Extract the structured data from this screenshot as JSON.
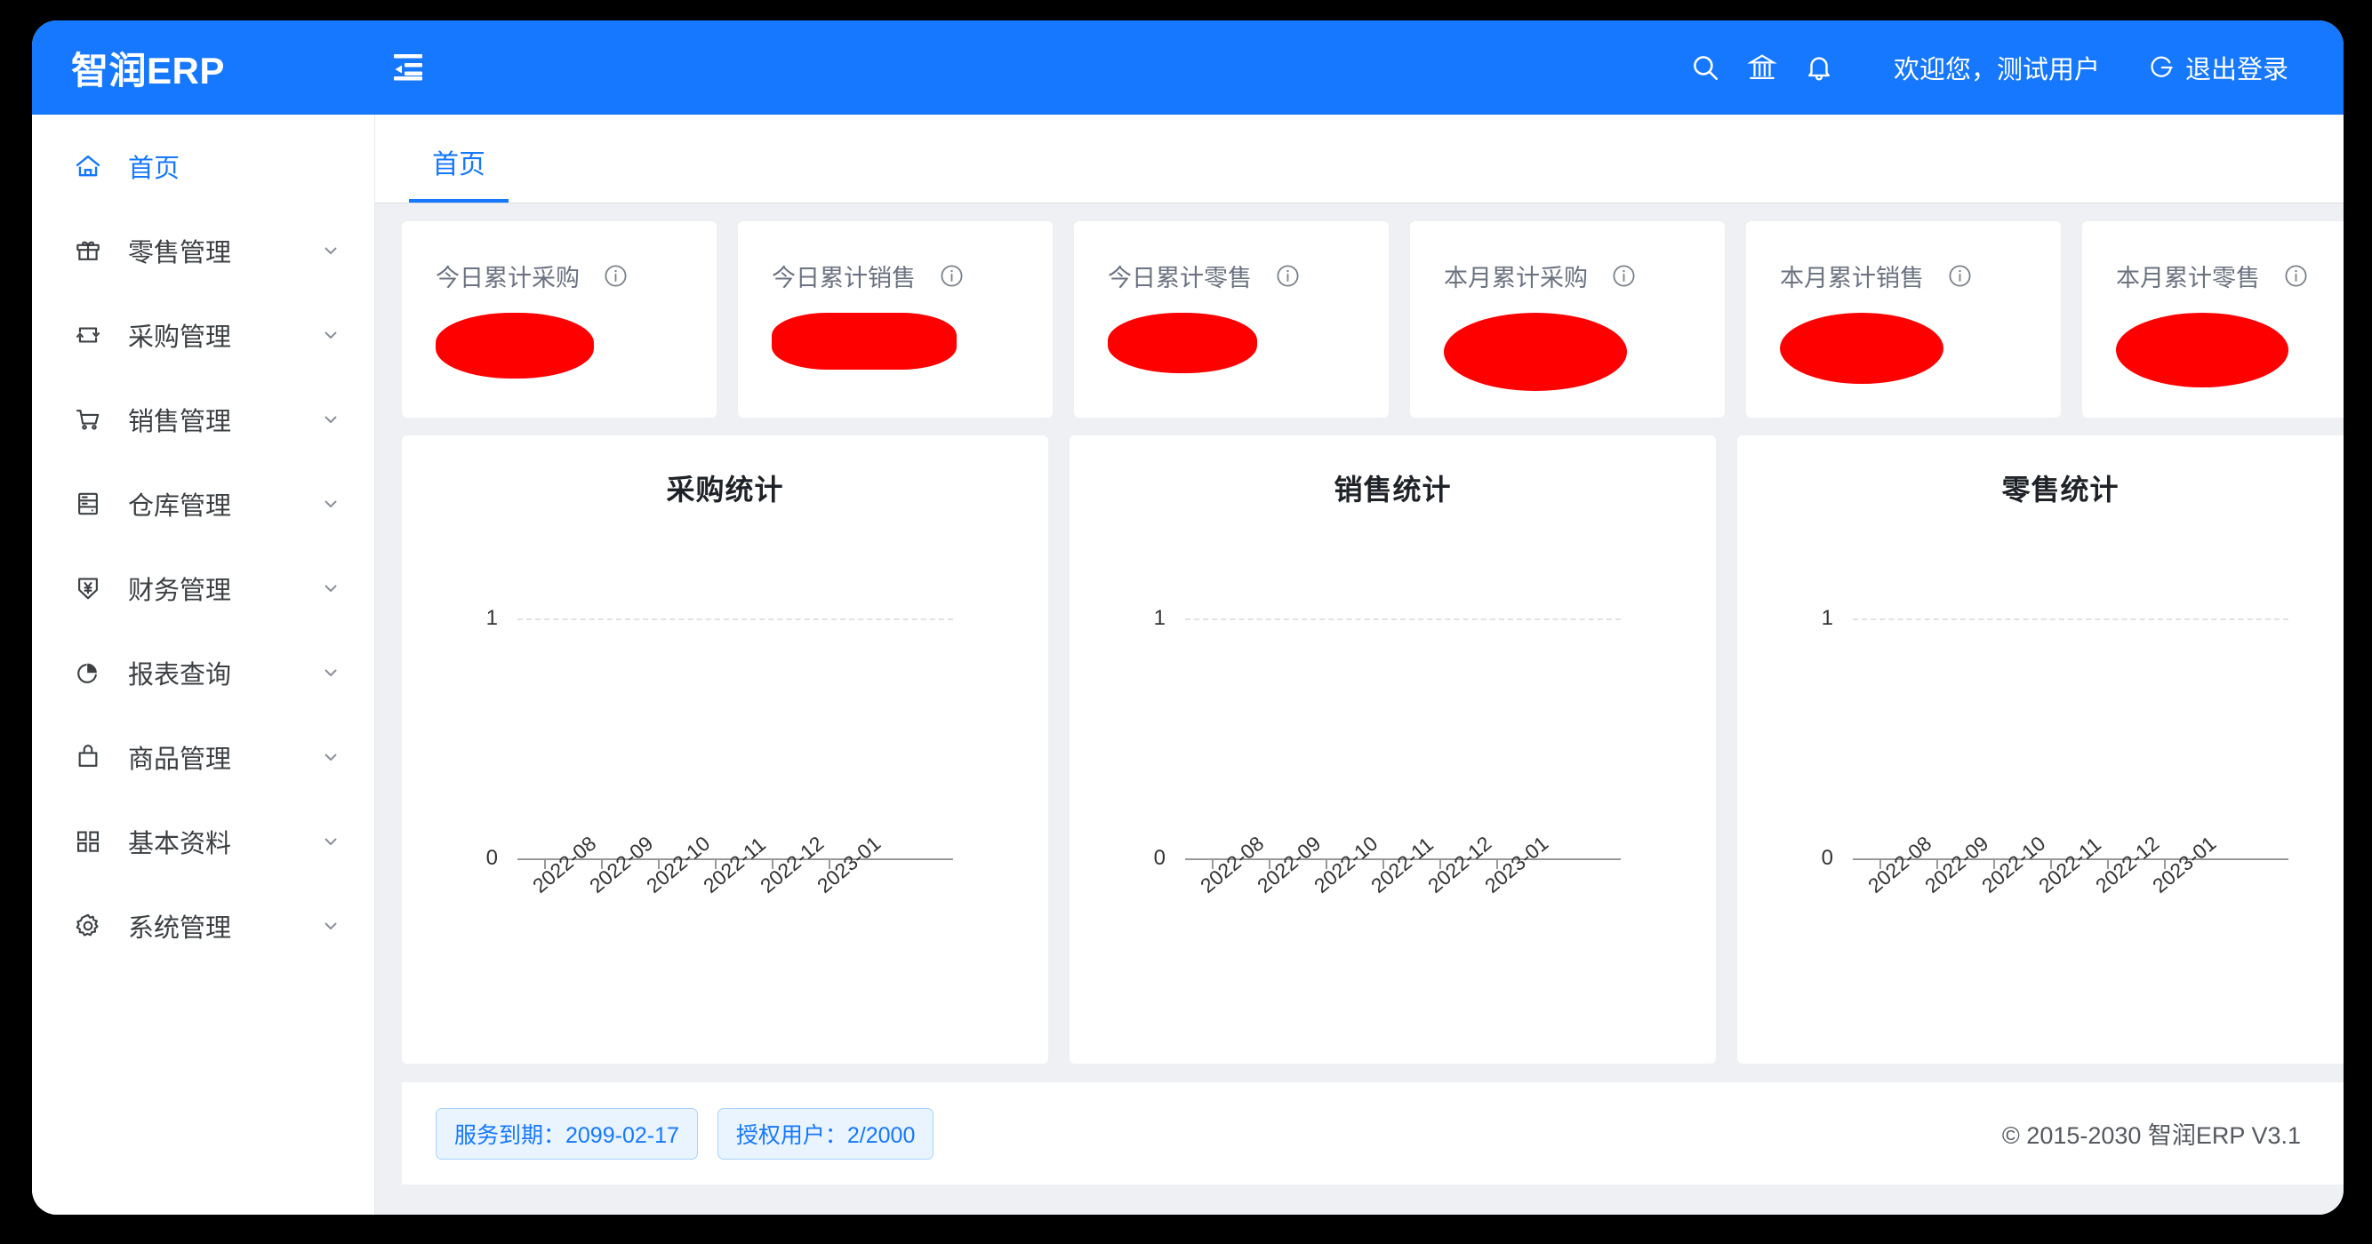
{
  "app": {
    "logo": "智润ERP"
  },
  "header": {
    "fold_icon": "menu-fold-icon",
    "search_icon": "search-icon",
    "enterprise_icon": "bank-icon",
    "bell_icon": "bell-icon",
    "welcome": "欢迎您，测试用户",
    "logout_label": "退出登录",
    "logout_icon": "logout-icon",
    "background_color": "#1677ff"
  },
  "sidebar": {
    "items": [
      {
        "label": "首页",
        "icon": "home-icon",
        "active": true,
        "expandable": false
      },
      {
        "label": "零售管理",
        "icon": "gift-icon",
        "active": false,
        "expandable": true
      },
      {
        "label": "采购管理",
        "icon": "sync-icon",
        "active": false,
        "expandable": true
      },
      {
        "label": "销售管理",
        "icon": "shopping-cart-icon",
        "active": false,
        "expandable": true
      },
      {
        "label": "仓库管理",
        "icon": "database-icon",
        "active": false,
        "expandable": true
      },
      {
        "label": "财务管理",
        "icon": "yen-shield-icon",
        "active": false,
        "expandable": true
      },
      {
        "label": "报表查询",
        "icon": "pie-chart-icon",
        "active": false,
        "expandable": true
      },
      {
        "label": "商品管理",
        "icon": "bag-icon",
        "active": false,
        "expandable": true
      },
      {
        "label": "基本资料",
        "icon": "appstore-icon",
        "active": false,
        "expandable": true
      },
      {
        "label": "系统管理",
        "icon": "gear-icon",
        "active": false,
        "expandable": true
      }
    ]
  },
  "tabs": [
    {
      "label": "首页",
      "active": true
    }
  ],
  "stats": [
    {
      "label": "今日累计采购",
      "value": "",
      "redacted": true,
      "info_icon": "info-circle-icon",
      "blob_w": 178,
      "blob_h": 74
    },
    {
      "label": "今日累计销售",
      "value": "",
      "redacted": true,
      "info_icon": "info-circle-icon",
      "blob_w": 208,
      "blob_h": 64
    },
    {
      "label": "今日累计零售",
      "value": "",
      "redacted": true,
      "info_icon": "info-circle-icon",
      "blob_w": 168,
      "blob_h": 68
    },
    {
      "label": "本月累计采购",
      "value": "",
      "redacted": true,
      "info_icon": "info-circle-icon",
      "blob_w": 206,
      "blob_h": 88
    },
    {
      "label": "本月累计销售",
      "value": "",
      "redacted": true,
      "info_icon": "info-circle-icon",
      "blob_w": 184,
      "blob_h": 80
    },
    {
      "label": "本月累计零售",
      "value": "",
      "redacted": true,
      "info_icon": "info-circle-icon",
      "blob_w": 194,
      "blob_h": 84
    }
  ],
  "chart_data": [
    {
      "type": "line",
      "title": "采购统计",
      "categories": [
        "2022-08",
        "2022-09",
        "2022-10",
        "2022-11",
        "2022-12",
        "2023-01"
      ],
      "values": [
        0,
        0,
        0,
        0,
        0,
        0
      ],
      "series": [
        {
          "name": "采购统计",
          "values": [
            0,
            0,
            0,
            0,
            0,
            0
          ]
        }
      ],
      "xlabel": "",
      "ylabel": "",
      "ylim": [
        0,
        1
      ],
      "yticks": [
        0,
        1
      ],
      "grid": true,
      "legend": "none"
    },
    {
      "type": "line",
      "title": "销售统计",
      "categories": [
        "2022-08",
        "2022-09",
        "2022-10",
        "2022-11",
        "2022-12",
        "2023-01"
      ],
      "values": [
        0,
        0,
        0,
        0,
        0,
        0
      ],
      "series": [
        {
          "name": "销售统计",
          "values": [
            0,
            0,
            0,
            0,
            0,
            0
          ]
        }
      ],
      "xlabel": "",
      "ylabel": "",
      "ylim": [
        0,
        1
      ],
      "yticks": [
        0,
        1
      ],
      "grid": true,
      "legend": "none"
    },
    {
      "type": "line",
      "title": "零售统计",
      "categories": [
        "2022-08",
        "2022-09",
        "2022-10",
        "2022-11",
        "2022-12",
        "2023-01"
      ],
      "values": [
        0,
        0,
        0,
        0,
        0,
        0
      ],
      "series": [
        {
          "name": "零售统计",
          "values": [
            0,
            0,
            0,
            0,
            0,
            0
          ]
        }
      ],
      "xlabel": "",
      "ylabel": "",
      "ylim": [
        0,
        1
      ],
      "yticks": [
        0,
        1
      ],
      "grid": true,
      "legend": "none"
    }
  ],
  "footer": {
    "badges": [
      {
        "text": "服务到期：2099-02-17"
      },
      {
        "text": "授权用户：2/2000"
      }
    ],
    "copyright": "© 2015-2030 智润ERP V3.1"
  }
}
